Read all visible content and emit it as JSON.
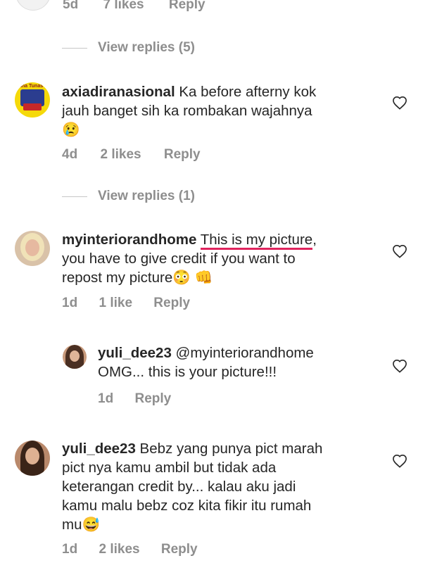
{
  "top_comment": {
    "time": "5d",
    "likes": "7 likes",
    "reply": "Reply",
    "view_replies": "View replies (5)"
  },
  "c1": {
    "username": "axiadiranasional",
    "line1": "Ka before afterny kok",
    "line2": "jauh banget sih ka rombakan wajahnya",
    "emoji": "😢",
    "time": "4d",
    "likes": "2 likes",
    "reply": "Reply",
    "view_replies": "View replies (1)",
    "avatar_text": "ana Tunas"
  },
  "c2": {
    "username": "myinteriorandhome",
    "highlight": "This is my picture",
    "line1_rest": ",",
    "line2": "you have to give credit if you want to",
    "line3": "repost my picture",
    "emoji": "😳 👊",
    "time": "1d",
    "likes": "1 like",
    "reply": "Reply"
  },
  "c3": {
    "username": "yuli_dee23",
    "mention": "@myinteriorandhome",
    "line2": "OMG... this is your picture!!!",
    "time": "1d",
    "reply": "Reply"
  },
  "c4": {
    "username": "yuli_dee23",
    "line1": "Bebz yang punya pict marah",
    "line2": "pict nya kamu ambil but tidak ada",
    "line3": "keterangan credit by... kalau aku jadi",
    "line4": "kamu malu bebz coz kita fikir itu rumah",
    "line5": "mu",
    "emoji": "😅",
    "time": "1d",
    "likes": "2 likes",
    "reply": "Reply"
  },
  "colors": {
    "text": "#262626",
    "meta": "#8e8e8e",
    "underline": "#e0245e"
  },
  "icons": [
    "heart-icon"
  ]
}
